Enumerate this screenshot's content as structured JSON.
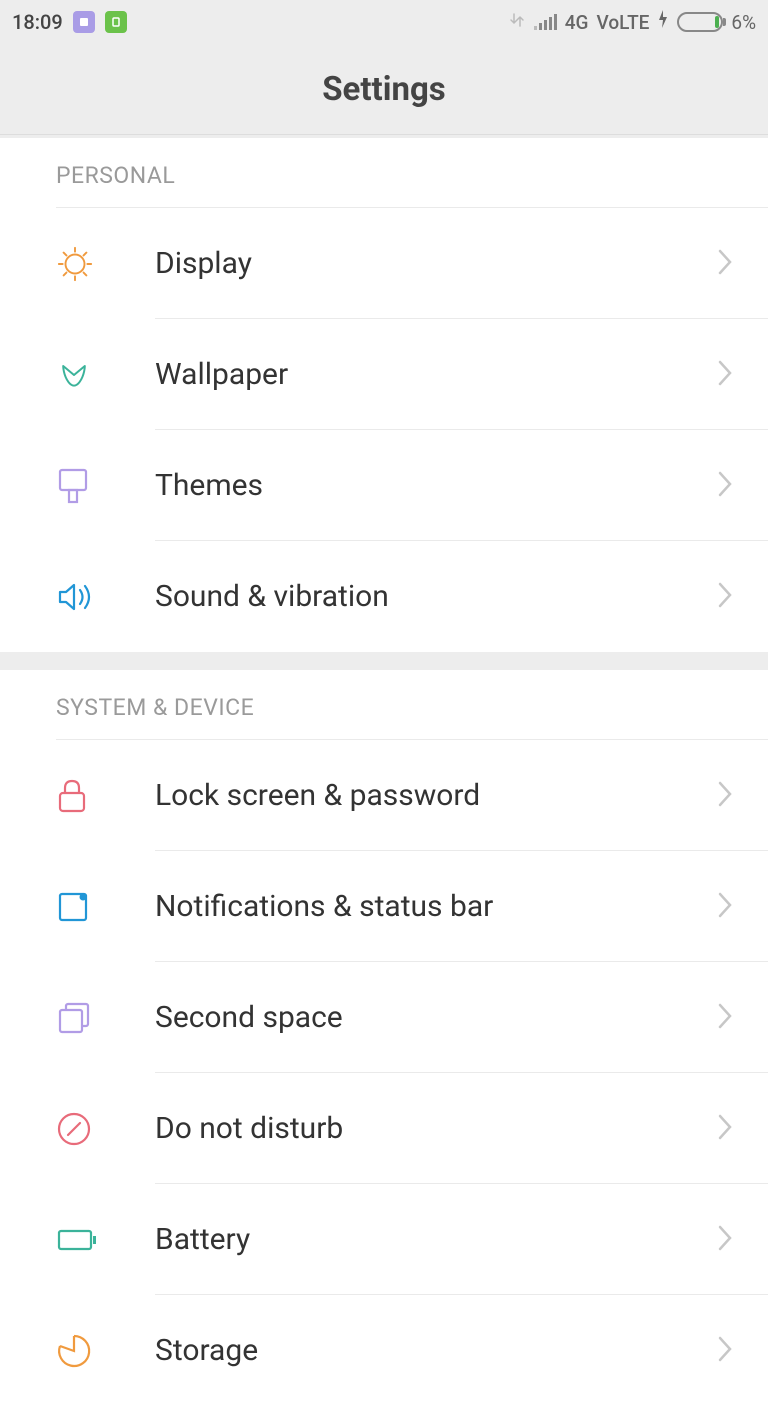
{
  "status": {
    "time": "18:09",
    "network": "4G",
    "volte": "VoLTE",
    "battery_pct": "6%"
  },
  "header": {
    "title": "Settings"
  },
  "sections": [
    {
      "title": "PERSONAL",
      "items": [
        {
          "label": "Display"
        },
        {
          "label": "Wallpaper"
        },
        {
          "label": "Themes"
        },
        {
          "label": "Sound & vibration"
        }
      ]
    },
    {
      "title": "SYSTEM & DEVICE",
      "items": [
        {
          "label": "Lock screen & password"
        },
        {
          "label": "Notifications & status bar"
        },
        {
          "label": "Second space"
        },
        {
          "label": "Do not disturb"
        },
        {
          "label": "Battery"
        },
        {
          "label": "Storage"
        }
      ]
    }
  ]
}
